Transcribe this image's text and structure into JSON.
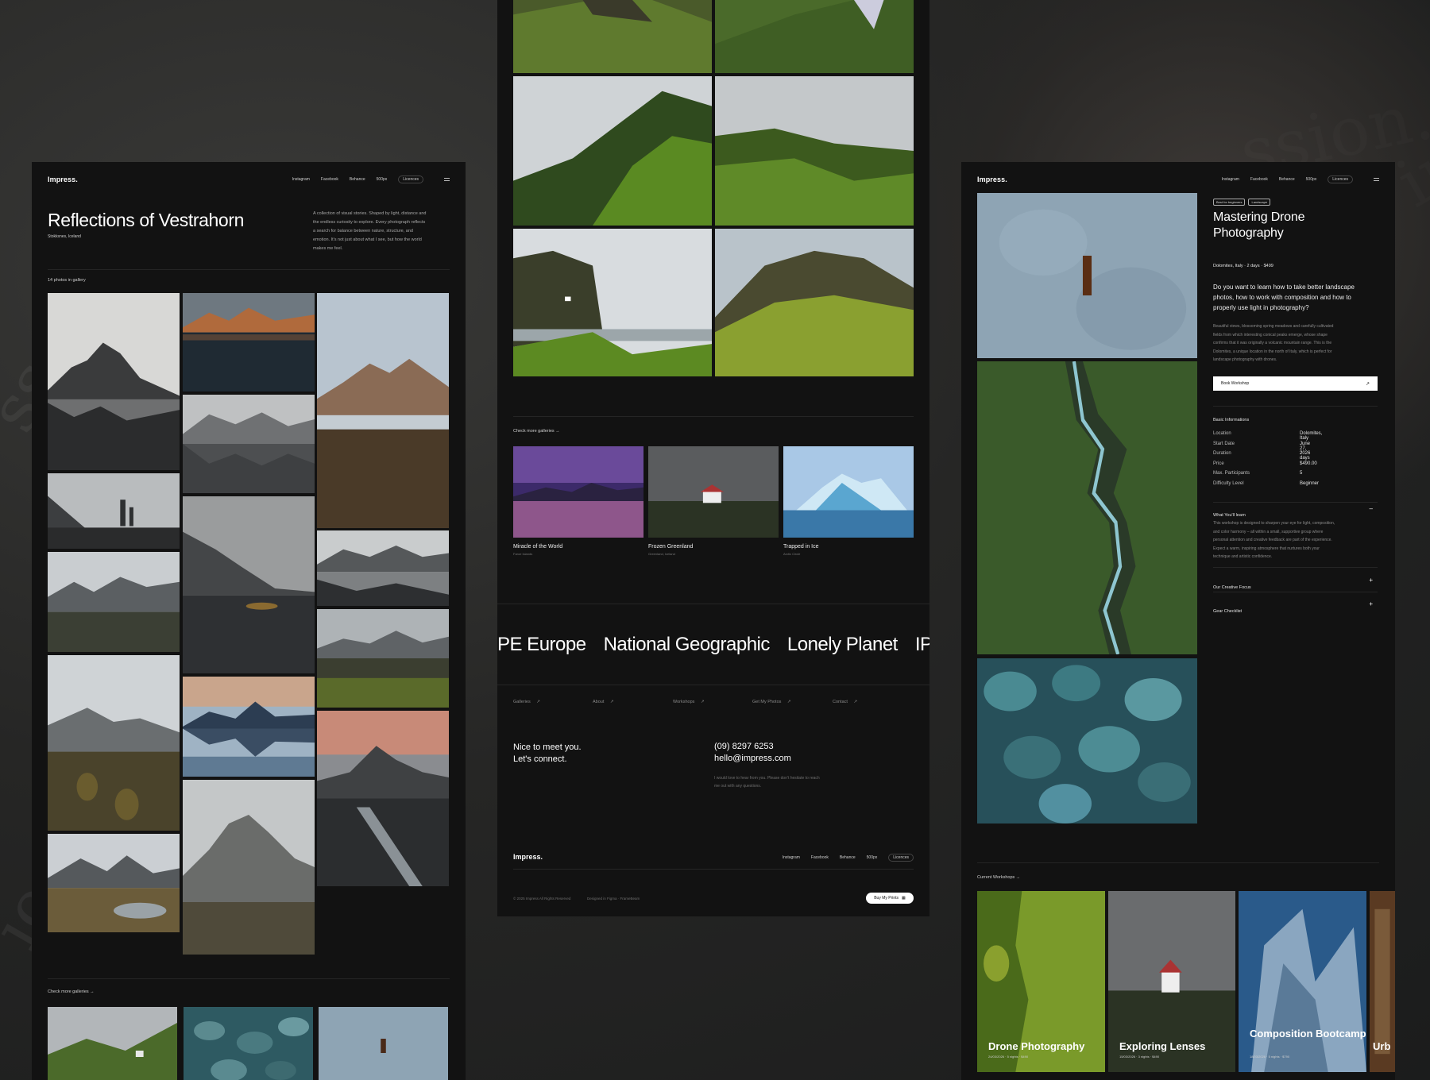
{
  "panel_left": {
    "brand": "Impress.",
    "nav": [
      "Instagram",
      "Facebook",
      "Behance",
      "500px",
      "Licences"
    ],
    "title": "Reflections of Vestrahorn",
    "location": "Stokksnes, Iceland",
    "description": [
      "A collection of visual stories. Shaped by light, distance and",
      "the endless curiosity to explore. Every photograph reflects",
      "a search for balance between nature, structure, and",
      "emotion. It's not just about what I see, but how the world",
      "makes me feel."
    ],
    "count": "14 photos in gallery",
    "more": "Check more galleries →"
  },
  "panel_center": {
    "more": "Check more galleries →",
    "galleries": [
      {
        "title": "Miracle of the World",
        "sub": "Faroe Islands"
      },
      {
        "title": "Frozen Greenland",
        "sub": "Greenland, Iceland"
      },
      {
        "title": "Trapped in Ice",
        "sub": "Arctic Circle"
      }
    ],
    "brands": [
      "PE Europe",
      "National Geographic",
      "Lonely Planet",
      "IPA"
    ],
    "footer_links": [
      "Galleries",
      "About",
      "Workshops",
      "Get My Photos",
      "Contact"
    ],
    "contact_heading": [
      "Nice to meet you.",
      "Let's connect."
    ],
    "phone": "(09) 8297 6253",
    "email": "hello@impress.com",
    "contact_note": [
      "I would love to hear from you. Please don't hesitate to reach",
      "me out with any questions."
    ],
    "brand": "Impress.",
    "nav": [
      "Instagram",
      "Facebook",
      "Behance",
      "500px",
      "Licences"
    ],
    "copyright": "© 2025 Impress All Rights Reserved",
    "credit": "Designed in Figma · FrameBeam",
    "buy_button": "Buy My Prints"
  },
  "panel_right": {
    "brand": "Impress.",
    "nav": [
      "Instagram",
      "Facebook",
      "Behance",
      "500px",
      "Licences"
    ],
    "tags": [
      "Best for beginners",
      "Landscape"
    ],
    "title": [
      "Mastering Drone",
      "Photography"
    ],
    "meta": "Dolomites, Italy  ·  2 days  ·  $499",
    "lead": [
      "Do you want to learn how to take better landscape",
      "photos, how to work with composition and how to",
      "properly use light in photography?"
    ],
    "body": [
      "Beautiful views, blossoming spring meadows and carefully cultivated",
      "fields from which interesting conical peaks emerge, whose shape",
      "confirms that it was originally a volcanic mountain range. This is the",
      "Dolomites, a unique location in the north of Italy, which is perfect for",
      "landscape photography with drones."
    ],
    "book_button": "Book Workshop",
    "info_heading": "Basic Informations",
    "info": [
      {
        "k": "Location",
        "v": "Dolomites, Italy"
      },
      {
        "k": "Start Date",
        "v": "June 27, 2026"
      },
      {
        "k": "Duration",
        "v": "2 days"
      },
      {
        "k": "Price",
        "v": "$490.00"
      },
      {
        "k": "Max. Participants",
        "v": "5"
      },
      {
        "k": "Difficulty Level",
        "v": "Beginner"
      }
    ],
    "learn_heading": "What You'll learn",
    "learn_body": [
      "This workshop is designed to sharpen your eye for light, composition,",
      "and color harmony – all within a small, supportive group where",
      "personal attention and creative feedback are part of the experience.",
      "Expect a warm, inspiring atmosphere that nurtures both your",
      "technique and artistic confidence."
    ],
    "acc1": "Our Creative Focus",
    "acc2": "Gear Checklist",
    "current": "Current Workshops →",
    "workshops": [
      {
        "title": "Drone Photography",
        "meta": "24/03/2026 · 5 nights · $490"
      },
      {
        "title": "Exploring Lenses",
        "meta": "15/03/2026 · 3 nights · $490"
      },
      {
        "title": "Composition Bootcamp",
        "meta": "18/03/2026 · 5 nights · $790"
      },
      {
        "title": "Urb"
      }
    ]
  },
  "colors": {
    "bg": "#1e1f1f",
    "panel": "#121212",
    "text": "#ffffff",
    "muted": "#8a8a8a"
  }
}
